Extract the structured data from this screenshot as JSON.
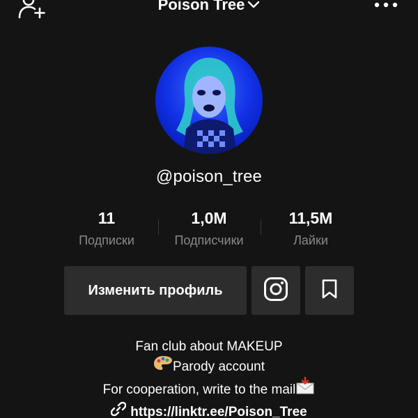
{
  "header": {
    "title": "Poison Tree",
    "add_friend_icon": "add-user-icon",
    "menu_icon": "more-dots-icon"
  },
  "profile": {
    "username": "@poison_tree",
    "avatar_color": "#0a2ad8"
  },
  "stats": [
    {
      "value": "11",
      "label": "Подписки"
    },
    {
      "value": "1,0M",
      "label": "Подписчики"
    },
    {
      "value": "11,5M",
      "label": "Лайки"
    }
  ],
  "actions": {
    "edit_label": "Изменить профиль",
    "instagram_icon": "instagram-icon",
    "bookmark_icon": "bookmark-icon"
  },
  "bio": {
    "line1": "Fan club about MAKEUP",
    "line2": "Parody account",
    "line3": "For cooperation, write to the mail",
    "link": "https://linktr.ee/Poison_Tree"
  },
  "colors": {
    "background": "#141414",
    "button": "#2d2d2d",
    "muted_text": "#8a8a8a"
  }
}
